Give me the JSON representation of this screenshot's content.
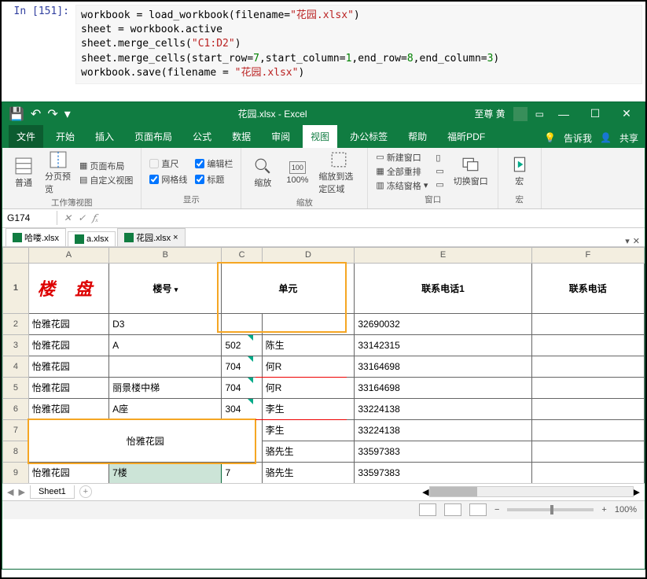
{
  "jupyter": {
    "prompt": "In [151]:",
    "lines": {
      "l1_a": "workbook = load_workbook(filename=",
      "l1_b": "\"花园.xlsx\"",
      "l1_c": ")",
      "l2": "sheet = workbook.active",
      "l3_a": "sheet.merge_cells(",
      "l3_b": "\"C1:D2\"",
      "l3_c": ")",
      "l4_a": "sheet.merge_cells(start_row=",
      "l4_b": "7",
      "l4_c": ",start_column=",
      "l4_d": "1",
      "l4_e": ",end_row=",
      "l4_f": "8",
      "l4_g": ",end_column=",
      "l4_h": "3",
      "l4_i": ")",
      "l5_a": "workbook.save(filename = ",
      "l5_b": "\"花园.xlsx\"",
      "l5_c": ")"
    }
  },
  "titlebar": {
    "title": "花园.xlsx - Excel",
    "user": "至尊 黄"
  },
  "tabs": [
    "文件",
    "开始",
    "插入",
    "页面布局",
    "公式",
    "数据",
    "审阅",
    "视图",
    "办公标签",
    "帮助",
    "福昕PDF"
  ],
  "tabs_right": {
    "tell": "告诉我",
    "share": "共享"
  },
  "active_tab_index": 7,
  "ribbon": {
    "views": {
      "normal": "普通",
      "pagebreak": "分页预览",
      "pagelayout": "页面布局",
      "custom": "自定义视图",
      "caption": "工作簿视图"
    },
    "show": {
      "ruler": "直尺",
      "formula": "编辑栏",
      "grid": "网格线",
      "heading": "标题",
      "caption": "显示"
    },
    "zoom": {
      "zoom": "缩放",
      "hundred": "100%",
      "selection": "缩放到选定区域",
      "caption": "缩放"
    },
    "window": {
      "neww": "新建窗口",
      "arrange": "全部重排",
      "freeze": "冻结窗格",
      "switch": "切换窗口",
      "caption": "窗口"
    },
    "macro": {
      "macro": "宏",
      "caption": "宏"
    }
  },
  "namebox": "G174",
  "filetabs": [
    "哈喽.xlsx",
    "a.xlsx",
    "花园.xlsx"
  ],
  "active_file_index": 2,
  "columns": [
    "A",
    "B",
    "C",
    "D",
    "E",
    "F"
  ],
  "header_row": {
    "loupan": "楼  盘",
    "bldg": "楼号",
    "unit": "单元",
    "phone1": "联系电话1",
    "phone2": "联系电话"
  },
  "rows": [
    {
      "r": "2",
      "a": "怡雅花园",
      "b": "D3",
      "c": "",
      "d": "",
      "e": "32690032"
    },
    {
      "r": "3",
      "a": "怡雅花园",
      "b": "A",
      "c": "502",
      "d": "陈生",
      "e": "33142315"
    },
    {
      "r": "4",
      "a": "怡雅花园",
      "b": "",
      "c": "704",
      "d": "何R",
      "e": "33164698"
    },
    {
      "r": "5",
      "a": "怡雅花园",
      "b": "丽景楼中梯",
      "c": "704",
      "d": "何R",
      "e": "33164698"
    },
    {
      "r": "6",
      "a": "怡雅花园",
      "b": "A座",
      "c": "304",
      "d": "李生",
      "e": "33224138"
    }
  ],
  "merged": {
    "text": "怡雅花园",
    "d7": "李生",
    "e7": "33224138",
    "d8": "骆先生",
    "e8": "33597383"
  },
  "row9": {
    "r": "9",
    "a": "怡雅花园",
    "b": "7楼",
    "c": "7",
    "d": "骆先生",
    "e": "33597383"
  },
  "sheet": "Sheet1",
  "zoom": "100%"
}
